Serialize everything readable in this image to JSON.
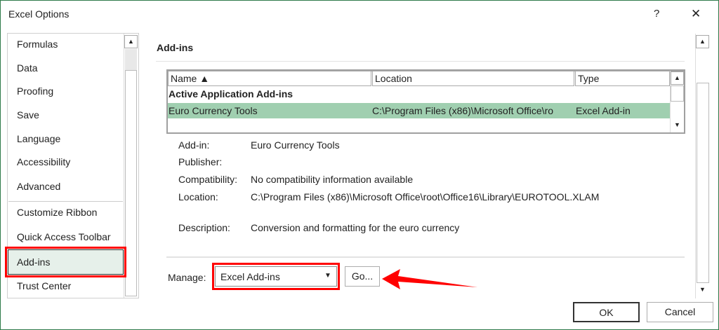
{
  "window": {
    "title": "Excel Options",
    "help": "?",
    "close": "✕"
  },
  "sidebar": {
    "items": [
      {
        "label": "Formulas"
      },
      {
        "label": "Data"
      },
      {
        "label": "Proofing"
      },
      {
        "label": "Save"
      },
      {
        "label": "Language"
      },
      {
        "label": "Accessibility"
      },
      {
        "label": "Advanced"
      },
      {
        "label": "Customize Ribbon"
      },
      {
        "label": "Quick Access Toolbar"
      },
      {
        "label": "Add-ins",
        "selected": true
      },
      {
        "label": "Trust Center"
      }
    ]
  },
  "main": {
    "section_title": "Add-ins",
    "table": {
      "columns": [
        "Name ▲",
        "Location",
        "Type"
      ],
      "group": "Active Application Add-ins",
      "rows": [
        {
          "name": "Euro Currency Tools",
          "location": "C:\\Program Files (x86)\\Microsoft Office\\ro",
          "type": "Excel Add-in",
          "selected": true
        }
      ]
    },
    "details": [
      {
        "label": "Add-in:",
        "value": "Euro Currency Tools"
      },
      {
        "label": "Publisher:",
        "value": ""
      },
      {
        "label": "Compatibility:",
        "value": "No compatibility information available"
      },
      {
        "label": "Location:",
        "value": "C:\\Program Files (x86)\\Microsoft Office\\root\\Office16\\Library\\EUROTOOL.XLAM"
      },
      {
        "label": "Description:",
        "value": "Conversion and formatting for the euro currency"
      }
    ],
    "manage": {
      "label": "Manage:",
      "selected": "Excel Add-ins",
      "go": "Go..."
    }
  },
  "footer": {
    "ok": "OK",
    "cancel": "Cancel"
  },
  "colors": {
    "selection": "#a0cfb0",
    "highlight": "#ff0000",
    "nav_selected": "#e6f0ea"
  }
}
